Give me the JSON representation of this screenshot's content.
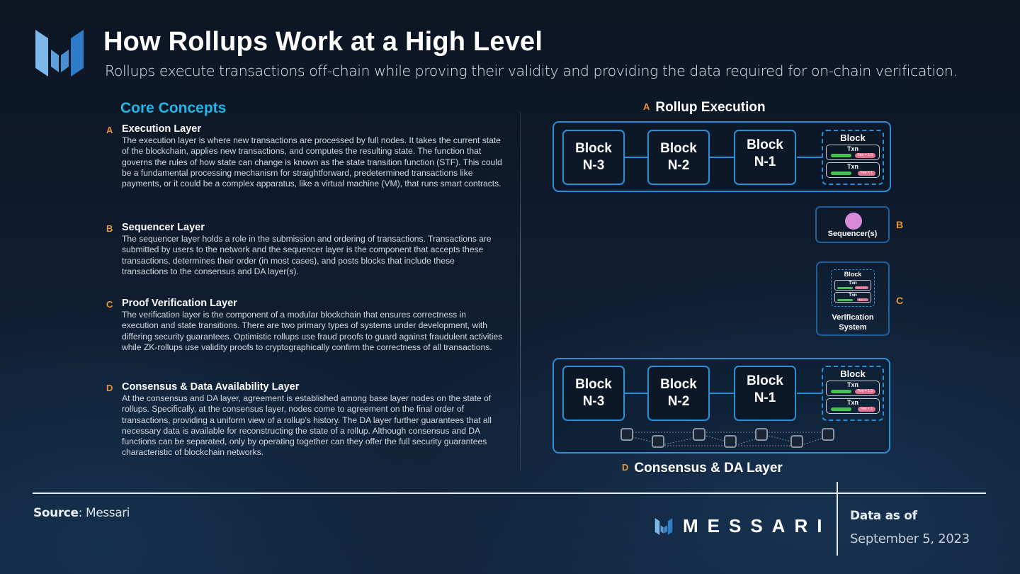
{
  "header": {
    "title": "How Rollups Work at a High Level",
    "subtitle": "Rollups execute transactions off-chain while proving their validity and providing the data required for on-chain verification.",
    "logo_icon": "messari-logo-icon"
  },
  "core_concepts": {
    "title": "Core Concepts",
    "items": [
      {
        "letter": "A",
        "heading": "Execution Layer",
        "body": "The execution layer is where new transactions are processed by full nodes. It takes the current state of the blockchain, applies new transactions, and computes the resulting state. The function that governs the rules of how state can change is known as the state transition function (STF). This could be a fundamental processing mechanism for straightforward, predetermined transactions like payments, or it could be a complex apparatus, like a virtual machine (VM), that runs smart contracts."
      },
      {
        "letter": "B",
        "heading": "Sequencer Layer",
        "body": "The sequencer layer holds a role in the submission and ordering of transactions. Transactions are submitted by users to the network and the sequencer layer is the component that accepts these transactions, determines their order (in most cases), and posts blocks that include these transactions to the consensus and DA layer(s)."
      },
      {
        "letter": "C",
        "heading": "Proof Verification Layer",
        "body": "The verification layer is the component of a modular blockchain that ensures correctness in execution and state transitions. There are two primary types of systems under development, with differing security guarantees. Optimistic rollups use fraud proofs to guard against fraudulent activities while ZK-rollups use validity proofs to cryptographically confirm the correctness of all transactions."
      },
      {
        "letter": "D",
        "heading": "Consensus & Data Availability Layer",
        "body": "At the consensus and DA layer, agreement is established among base layer nodes on the state of rollups. Specifically, at the consensus layer, nodes come to agreement on the final order of transactions, providing a uniform view of a rollup’s history. The DA layer further guarantees that all necessary data is available for reconstructing the state of a rollup. Although consensus and DA functions can be separated, only by operating together can they offer the full security guarantees characteristic of blockchain networks."
      }
    ]
  },
  "diagram": {
    "execution": {
      "letter": "A",
      "title": "Rollup Execution",
      "blocks": [
        {
          "line1": "Block",
          "line2": "N-3"
        },
        {
          "line1": "Block",
          "line2": "N-2"
        },
        {
          "line1": "Block",
          "line2": "N-1"
        }
      ],
      "pending_block": {
        "title": "Block",
        "txns": [
          {
            "label": "Txn",
            "fee": "Fee = 1.5"
          },
          {
            "label": "Txn",
            "fee": "Fee = 1"
          }
        ]
      }
    },
    "sequencer": {
      "letter": "B",
      "label": "Sequencer(s)"
    },
    "verification": {
      "letter": "C",
      "label_line1": "Verification",
      "label_line2": "System",
      "mini_block": {
        "title": "Block",
        "txns": [
          {
            "label": "Txn",
            "fee": "Fee = 1.5"
          },
          {
            "label": "Txn",
            "fee": "Fee = 1"
          }
        ]
      }
    },
    "consensus": {
      "letter": "D",
      "title": "Consensus & DA Layer",
      "blocks": [
        {
          "line1": "Block",
          "line2": "N-3"
        },
        {
          "line1": "Block",
          "line2": "N-2"
        },
        {
          "line1": "Block",
          "line2": "N-1"
        }
      ],
      "pending_block": {
        "title": "Block",
        "txns": [
          {
            "label": "Txn",
            "fee": "Fee = 1.5"
          },
          {
            "label": "Txn",
            "fee": "Fee = 1"
          }
        ]
      },
      "node_count": 7
    },
    "colors": {
      "accent_blue": "#2a8fd6",
      "letter_orange": "#e8953a",
      "concepts_cyan": "#1fb6e8",
      "sequencer_pink": "#d88ad8",
      "txn_green": "#46c34f",
      "fee_pink": "#e0708c"
    }
  },
  "footer": {
    "source_label": "Source",
    "source_value": ": Messari",
    "brand": "MESSARI",
    "data_as_of_label": "Data as of",
    "data_date": "September 5, 2023"
  }
}
